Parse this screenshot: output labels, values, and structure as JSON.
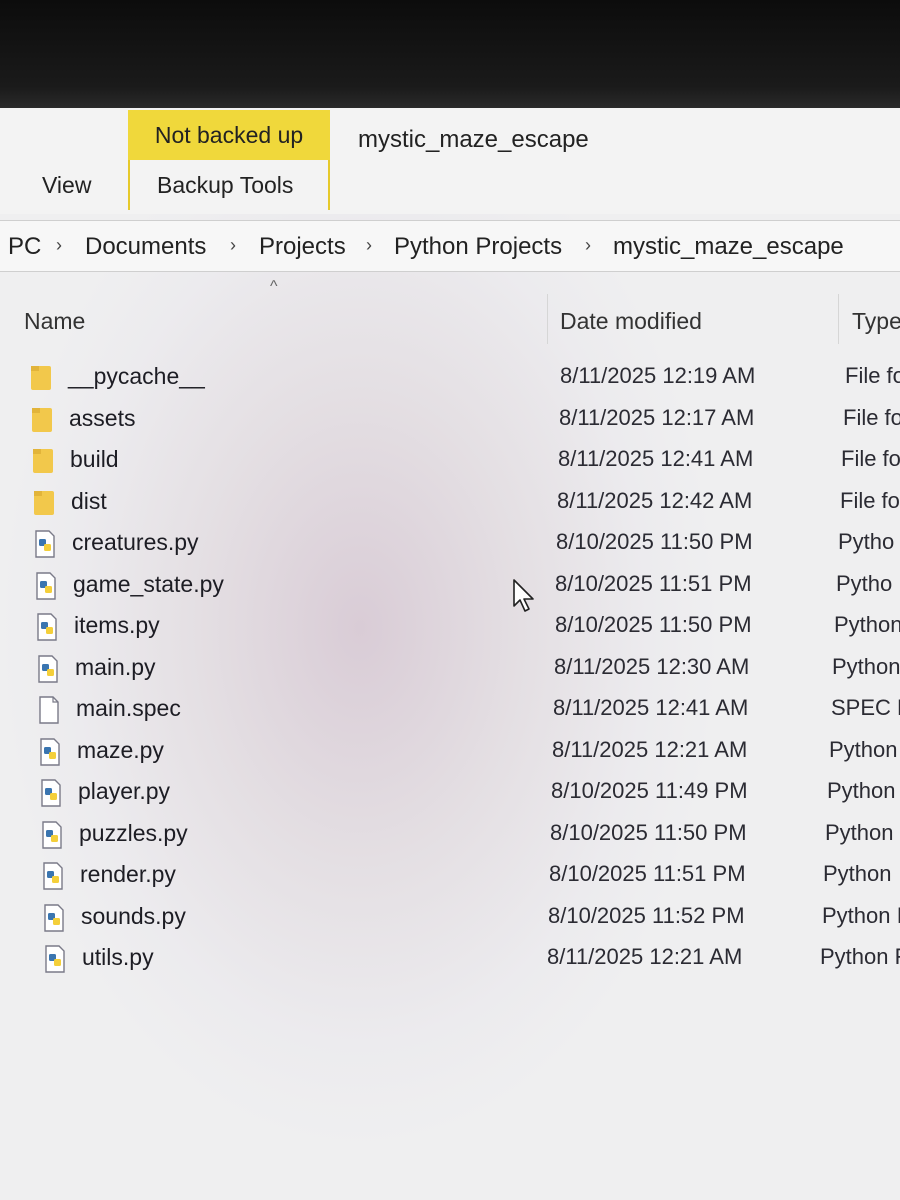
{
  "ribbon": {
    "status_tab": "Not backed up",
    "window_title": "mystic_maze_escape",
    "view_label": "View",
    "backup_tools_label": "Backup Tools",
    "accent": "#f0d83b"
  },
  "breadcrumb": [
    "PC",
    "Documents",
    "Projects",
    "Python Projects",
    "mystic_maze_escape"
  ],
  "columns": {
    "name": "Name",
    "date": "Date modified",
    "type": "Type"
  },
  "files": [
    {
      "name": "__pycache__",
      "date": "8/11/2025 12:19 AM",
      "type": "File fo",
      "icon": "folder-icon"
    },
    {
      "name": "assets",
      "date": "8/11/2025 12:17 AM",
      "type": "File fo",
      "icon": "folder-icon"
    },
    {
      "name": "build",
      "date": "8/11/2025 12:41 AM",
      "type": "File fo",
      "icon": "folder-icon"
    },
    {
      "name": "dist",
      "date": "8/11/2025 12:42 AM",
      "type": "File fo",
      "icon": "folder-icon"
    },
    {
      "name": "creatures.py",
      "date": "8/10/2025 11:50 PM",
      "type": "Pytho",
      "icon": "python-file-icon"
    },
    {
      "name": "game_state.py",
      "date": "8/10/2025 11:51 PM",
      "type": "Pytho",
      "icon": "python-file-icon"
    },
    {
      "name": "items.py",
      "date": "8/10/2025 11:50 PM",
      "type": "Python",
      "icon": "python-file-icon"
    },
    {
      "name": "main.py",
      "date": "8/11/2025 12:30 AM",
      "type": "Python",
      "icon": "python-file-icon"
    },
    {
      "name": "main.spec",
      "date": "8/11/2025 12:41 AM",
      "type": "SPEC F",
      "icon": "blank-file-icon"
    },
    {
      "name": "maze.py",
      "date": "8/11/2025 12:21 AM",
      "type": "Python",
      "icon": "python-file-icon"
    },
    {
      "name": "player.py",
      "date": "8/10/2025 11:49 PM",
      "type": "Python",
      "icon": "python-file-icon"
    },
    {
      "name": "puzzles.py",
      "date": "8/10/2025 11:50 PM",
      "type": "Python",
      "icon": "python-file-icon"
    },
    {
      "name": "render.py",
      "date": "8/10/2025 11:51 PM",
      "type": "Python",
      "icon": "python-file-icon"
    },
    {
      "name": "sounds.py",
      "date": "8/10/2025 11:52 PM",
      "type": "Python I",
      "icon": "python-file-icon"
    },
    {
      "name": "utils.py",
      "date": "8/11/2025 12:21 AM",
      "type": "Python F",
      "icon": "python-file-icon"
    }
  ]
}
